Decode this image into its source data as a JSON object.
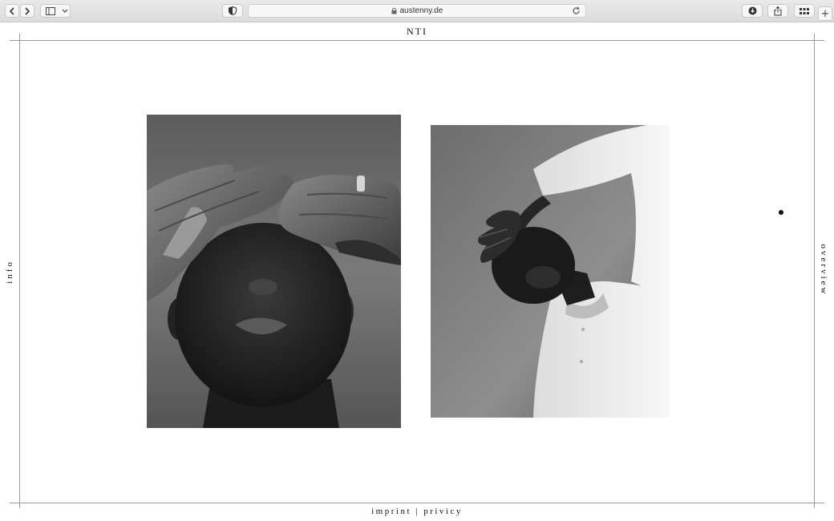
{
  "browser": {
    "url": "austenny.de",
    "back_icon": "chevron-left-icon",
    "forward_icon": "chevron-right-icon",
    "sidebar_icon": "sidebar-icon",
    "privacy_icon": "shield-icon",
    "download_icon": "download-icon",
    "share_icon": "share-icon",
    "tabs_icon": "tab-overview-icon",
    "new_tab_symbol": "+"
  },
  "page": {
    "title": "NTI",
    "left_nav": "info",
    "right_nav": "overview",
    "footer": {
      "imprint": "imprint",
      "separator": "|",
      "privacy": "privicy"
    }
  },
  "gallery": {
    "images": [
      {
        "name": "portrait-hands-over-eyes",
        "style": "black-and-white"
      },
      {
        "name": "portrait-white-shirt-arm-raised",
        "style": "black-and-white"
      }
    ]
  },
  "colors": {
    "frame_line": "#9a9a9a",
    "text": "#111111",
    "background": "#ffffff"
  }
}
